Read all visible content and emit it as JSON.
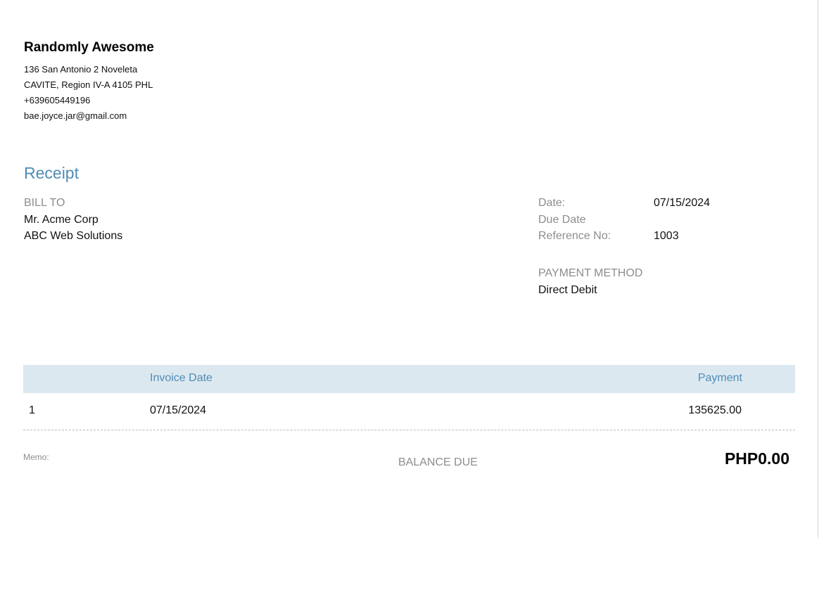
{
  "company": {
    "name": "Randomly Awesome",
    "address_line1": "136 San Antonio 2 Noveleta",
    "address_line2": "CAVITE, Region IV-A  4105 PHL",
    "phone": "+639605449196",
    "email": "bae.joyce.jar@gmail.com"
  },
  "document": {
    "title": "Receipt"
  },
  "bill_to": {
    "label": "BILL TO",
    "name": "Mr. Acme Corp",
    "company": "ABC Web Solutions"
  },
  "meta": {
    "date_label": "Date:",
    "date_value": "07/15/2024",
    "due_date_label": "Due Date",
    "due_date_value": "",
    "reference_label": "Reference No:",
    "reference_value": "1003"
  },
  "payment_method": {
    "label": "PAYMENT METHOD",
    "value": "Direct Debit"
  },
  "table": {
    "headers": {
      "invoice_date": "Invoice Date",
      "payment": "Payment"
    },
    "rows": [
      {
        "number": "1",
        "invoice_date": "07/15/2024",
        "payment": "135625.00"
      }
    ]
  },
  "footer": {
    "memo_label": "Memo:",
    "balance_label": "BALANCE DUE",
    "balance_value": "PHP0.00"
  }
}
